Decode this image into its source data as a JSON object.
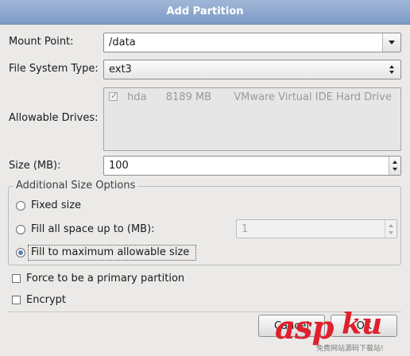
{
  "window": {
    "title": "Add Partition"
  },
  "mount_point": {
    "label": "Mount Point:",
    "value": "/data"
  },
  "fs_type": {
    "label": "File System Type:",
    "value": "ext3"
  },
  "drives": {
    "label": "Allowable Drives:",
    "items": [
      {
        "checked": true,
        "name": "hda",
        "size": "8189 MB",
        "model": "VMware Virtual IDE Hard Drive"
      }
    ]
  },
  "size": {
    "label": "Size (MB):",
    "value": "100"
  },
  "additional": {
    "legend": "Additional Size Options",
    "fixed_label": "Fixed size",
    "fill_upto_label": "Fill all space up to (MB):",
    "fill_upto_value": "1",
    "fill_max_label": "Fill to maximum allowable size",
    "selected": "fill_max"
  },
  "primary": {
    "label": "Force to be a primary partition",
    "checked": false
  },
  "encrypt": {
    "label": "Encrypt",
    "checked": false
  },
  "buttons": {
    "cancel": "Cancel",
    "ok": "OK"
  },
  "watermark": {
    "brand": "asp",
    "brand2": "ku",
    "sub": "免费网站源码下载站!"
  },
  "icons": {
    "combo": "chevron-down-icon",
    "spin": "spin-arrows-icon"
  }
}
